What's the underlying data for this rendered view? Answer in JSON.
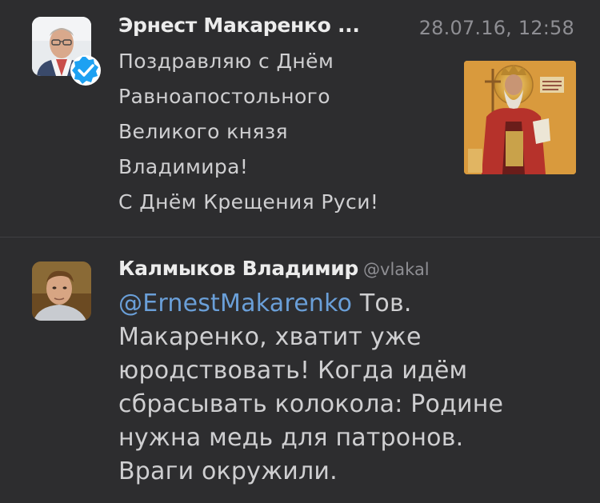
{
  "tweets": [
    {
      "author": "Эрнест Макаренко ...",
      "timestamp": "28.07.16, 12:58",
      "verified": true,
      "text_lines": [
        "Поздравляю с Днём",
        "Равноапостольного",
        "Великого князя",
        "Владимира!",
        "С Днём Крещения Руси!"
      ]
    },
    {
      "author": "Калмыков Владимир",
      "handle": "@vlakal",
      "mention": "@ErnestMakarenko",
      "first_line_rest": " Тов.",
      "text_lines": [
        "Макаренко, хватит уже",
        "юродствовать! Когда идём",
        "сбрасывать колокола: Родине",
        "нужна медь для патронов.",
        "Враги окружили."
      ]
    }
  ],
  "colors": {
    "background": "#2d2d2f",
    "mention": "#6a9fd8",
    "verified": "#1da1f2"
  },
  "icons": {
    "verified": "verified-badge-icon"
  }
}
